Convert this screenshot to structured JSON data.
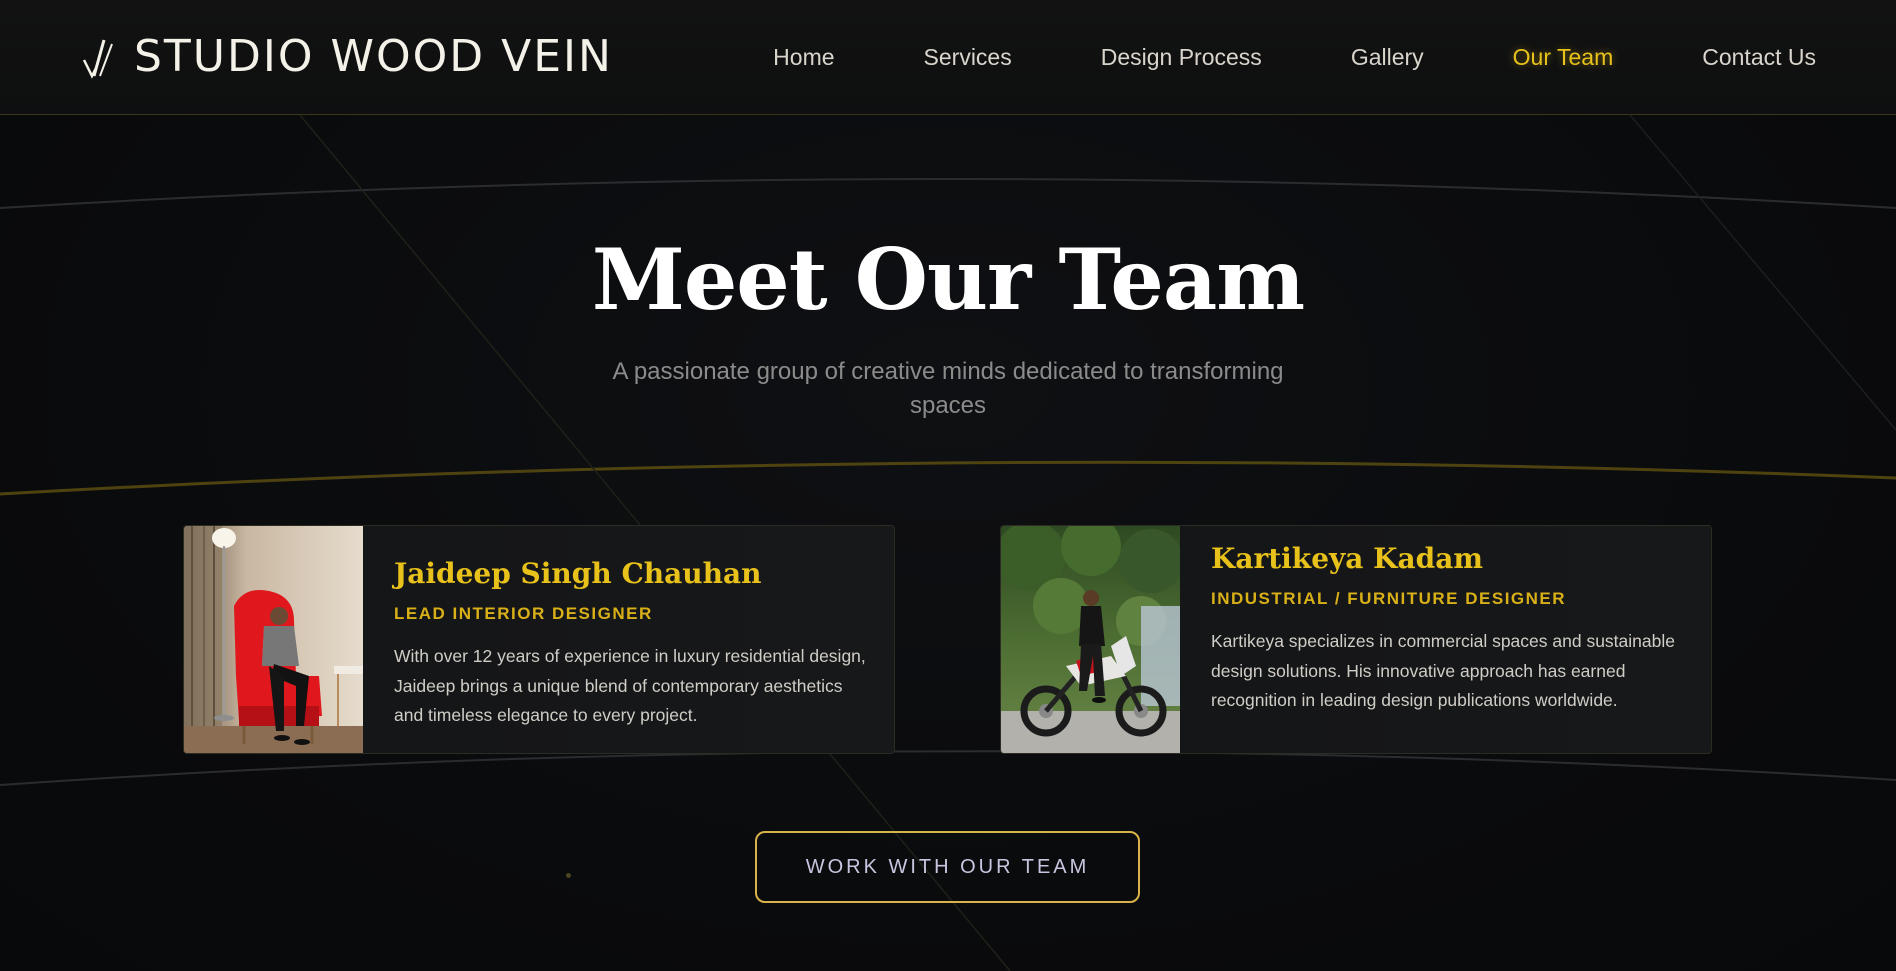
{
  "brand": {
    "name": "STUDIO WOOD VEIN",
    "logo_icon": "sv-monogram-icon"
  },
  "nav": {
    "items": [
      {
        "label": "Home"
      },
      {
        "label": "Services"
      },
      {
        "label": "Design Process"
      },
      {
        "label": "Gallery"
      },
      {
        "label": "Our Team",
        "active": true
      },
      {
        "label": "Contact Us"
      }
    ]
  },
  "hero": {
    "title": "Meet Our Team",
    "subtitle": "A passionate group of creative minds dedicated to transforming spaces"
  },
  "team": [
    {
      "name": "Jaideep Singh Chauhan",
      "role": "LEAD INTERIOR DESIGNER",
      "bio": "With over 12 years of experience in luxury residential design, Jaideep brings a unique blend of contemporary aesthetics and timeless elegance to every project.",
      "photo": "man-in-red-armchair-photo"
    },
    {
      "name": "Kartikeya Kadam",
      "role": "INDUSTRIAL / FURNITURE DESIGNER",
      "bio": "Kartikeya specializes in commercial spaces and sustainable design solutions. His innovative approach has earned recognition in leading design publications worldwide.",
      "photo": "man-on-motorcycle-photo"
    }
  ],
  "cta": {
    "label": "WORK WITH OUR TEAM"
  },
  "colors": {
    "background": "#0a0b0d",
    "accent": "#e8c21b",
    "cta_border": "#d9b24a",
    "text": "#d9d5cc"
  }
}
